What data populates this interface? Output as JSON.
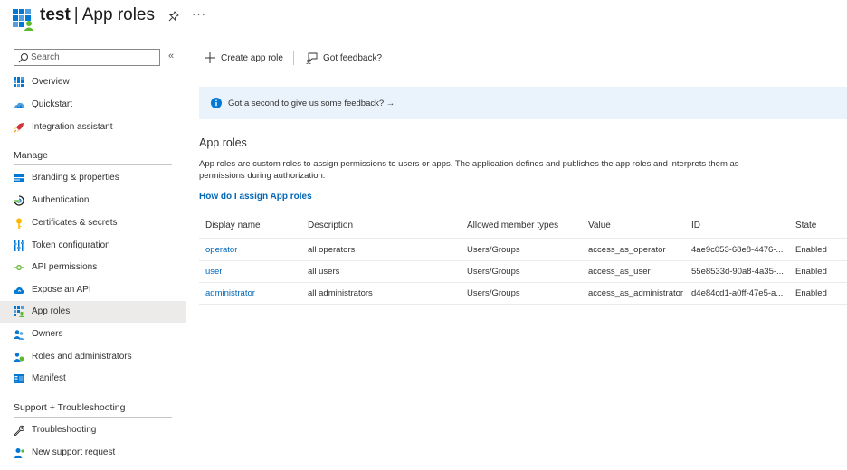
{
  "header": {
    "app_name": "test",
    "separator": "|",
    "page_title": "App roles",
    "more": "···"
  },
  "sidebar": {
    "search_placeholder": "Search",
    "collapse": "«",
    "items": [
      {
        "label": "Overview",
        "icon": "overview-icon"
      },
      {
        "label": "Quickstart",
        "icon": "quickstart-icon"
      },
      {
        "label": "Integration assistant",
        "icon": "rocket-icon"
      }
    ],
    "sections": [
      {
        "title": "Manage",
        "items": [
          {
            "label": "Branding & properties",
            "icon": "branding-icon"
          },
          {
            "label": "Authentication",
            "icon": "authentication-icon"
          },
          {
            "label": "Certificates & secrets",
            "icon": "key-icon"
          },
          {
            "label": "Token configuration",
            "icon": "token-icon"
          },
          {
            "label": "API permissions",
            "icon": "api-permissions-icon"
          },
          {
            "label": "Expose an API",
            "icon": "cloud-icon"
          },
          {
            "label": "App roles",
            "icon": "app-roles-icon",
            "active": true
          },
          {
            "label": "Owners",
            "icon": "owners-icon"
          },
          {
            "label": "Roles and administrators",
            "icon": "roles-admin-icon"
          },
          {
            "label": "Manifest",
            "icon": "manifest-icon"
          }
        ]
      },
      {
        "title": "Support + Troubleshooting",
        "items": [
          {
            "label": "Troubleshooting",
            "icon": "wrench-icon"
          },
          {
            "label": "New support request",
            "icon": "support-icon"
          }
        ]
      }
    ]
  },
  "toolbar": {
    "create_label": "Create app role",
    "feedback_label": "Got feedback?"
  },
  "banner": {
    "text": "Got a second to give us some feedback? →"
  },
  "content": {
    "heading": "App roles",
    "description": "App roles are custom roles to assign permissions to users or apps. The application defines and publishes the app roles and interprets them as permissions during authorization.",
    "link": "How do I assign App roles"
  },
  "table": {
    "columns": [
      "Display name",
      "Description",
      "Allowed member types",
      "Value",
      "ID",
      "State"
    ],
    "rows": [
      {
        "display_name": "operator",
        "description": "all operators",
        "allowed": "Users/Groups",
        "value": "access_as_operator",
        "id": "4ae9c053-68e8-4476-...",
        "state": "Enabled"
      },
      {
        "display_name": "user",
        "description": "all users",
        "allowed": "Users/Groups",
        "value": "access_as_user",
        "id": "55e8533d-90a8-4a35-...",
        "state": "Enabled"
      },
      {
        "display_name": "administrator",
        "description": "all administrators",
        "allowed": "Users/Groups",
        "value": "access_as_administrator",
        "id": "d4e84cd1-a0ff-47e5-a...",
        "state": "Enabled"
      }
    ]
  },
  "colors": {
    "accent": "#0078d4",
    "link": "#0066b8",
    "banner_bg": "#eaf2fb",
    "active_bg": "#edebe9"
  }
}
